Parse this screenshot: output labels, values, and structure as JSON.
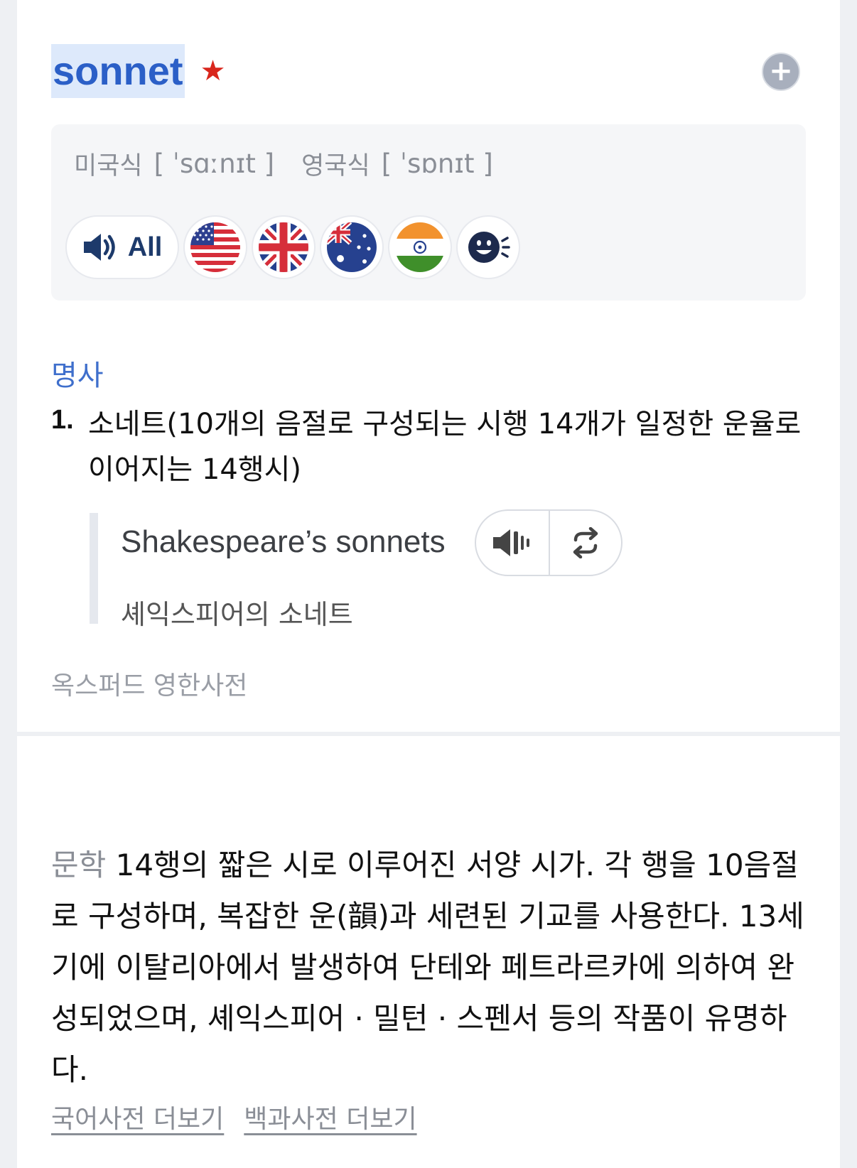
{
  "entry": {
    "headword": "sonnet",
    "star_icon": "star-icon",
    "add_icon": "plus-icon",
    "pronunciation": {
      "us_label": "미국식",
      "us_ipa": "[ ˈsɑːnɪt ]",
      "uk_label": "영국식",
      "uk_ipa": "[ ˈsɒnɪt ]"
    },
    "audio": {
      "all_label": "All",
      "flags": [
        "us-flag-icon",
        "uk-flag-icon",
        "au-flag-icon",
        "in-flag-icon",
        "face-speak-icon"
      ]
    },
    "part_of_speech": "명사",
    "definition": {
      "number": "1.",
      "text": "소네트(10개의 음절로 구성되는 시행 14개가 일정한 운율로 이어지는 14행시)"
    },
    "example": {
      "en": "Shakespeare’s sonnets",
      "ko": "셰익스피어의 소네트"
    },
    "source": "옥스퍼드 영한사전"
  },
  "encyclopedia": {
    "field": "문학",
    "text": "14행의 짧은 시로 이루어진 서양 시가. 각 행을 10음절로 구성하며, 복잡한 운(韻)과 세련된 기교를 사용한다. 13세기에 이탈리아에서 발생하여 단테와 페트라르카에 의하여 완성되었으며, 셰익스피어 · 밀턴 · 스펜서 등의 작품이 유명하다.",
    "links": [
      "국어사전 더보기",
      "백과사전 더보기"
    ]
  },
  "colors": {
    "headword": "#2b5fc7",
    "headword_highlight": "#dde9fb",
    "star": "#d9261c",
    "pos": "#3f6fcc"
  }
}
